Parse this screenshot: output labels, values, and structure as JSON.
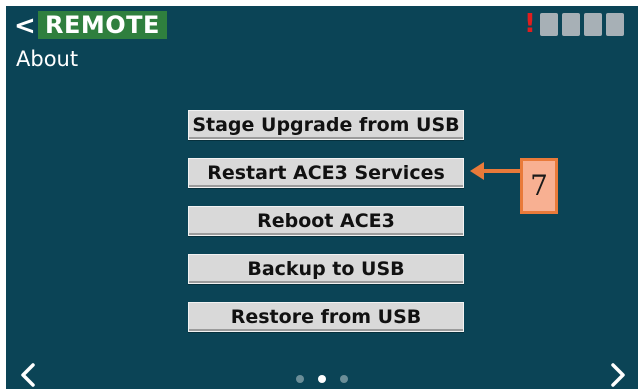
{
  "header": {
    "back_glyph": "<",
    "mode_badge": "REMOTE",
    "page_title": "About",
    "alert_glyph": "!",
    "status_indicator_count": 4
  },
  "menu": {
    "buttons": [
      {
        "label": "Stage Upgrade from USB"
      },
      {
        "label": "Restart ACE3 Services"
      },
      {
        "label": "Reboot ACE3"
      },
      {
        "label": "Backup to USB"
      },
      {
        "label": "Restore from USB"
      }
    ]
  },
  "annotation": {
    "callout_number": "7"
  },
  "pager": {
    "page_count": 3,
    "current_page": 2
  },
  "colors": {
    "background": "#0b4456",
    "badge": "#2f7f3e",
    "alert": "#e01e1e",
    "button": "#d9d9d9",
    "callout_fill": "#f8b092",
    "callout_border": "#e97a3a"
  },
  "icons": {
    "back": "chevron-left-icon",
    "alert": "exclamation-icon",
    "prev": "chevron-left-icon",
    "next": "chevron-right-icon"
  }
}
